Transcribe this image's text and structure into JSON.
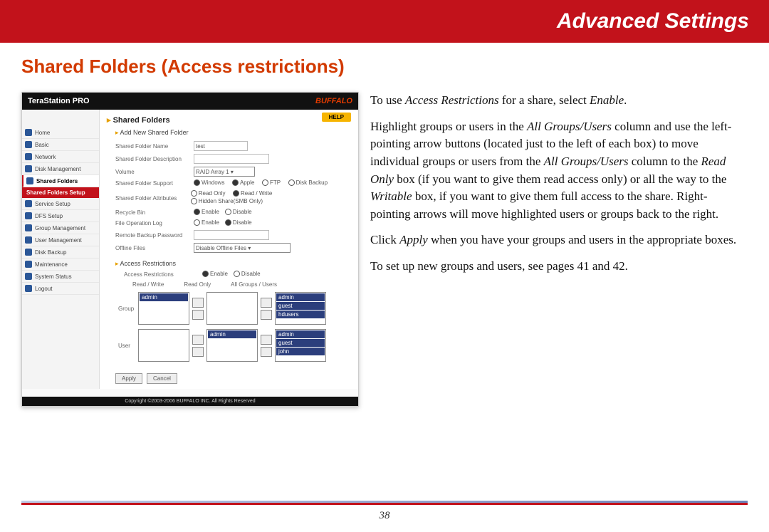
{
  "banner": {
    "title": "Advanced Settings"
  },
  "section_title": "Shared Folders (Access restrictions)",
  "page_number": "38",
  "shot": {
    "product": "TeraStation PRO",
    "brand": "BUFFALO",
    "help": "HELP",
    "sidebar": [
      "Home",
      "Basic",
      "Network",
      "Disk Management",
      "Shared Folders",
      "Service Setup",
      "DFS Setup",
      "Group Management",
      "User Management",
      "Disk Backup",
      "Maintenance",
      "System Status",
      "Logout"
    ],
    "sidebar_sub": "Shared Folders Setup",
    "main_title": "Shared Folders",
    "add_section": "Add New Shared Folder",
    "fields": [
      {
        "label": "Shared Folder Name",
        "value": "test"
      },
      {
        "label": "Shared Folder Description",
        "value": ""
      },
      {
        "label": "Volume",
        "value": "RAID Array 1 ▾"
      },
      {
        "label": "Shared Folder Support",
        "value": ""
      },
      {
        "label": "Shared Folder Attributes",
        "value": ""
      },
      {
        "label": "Recycle Bin",
        "value": ""
      },
      {
        "label": "File Operation Log",
        "value": ""
      },
      {
        "label": "Remote Backup Password",
        "value": ""
      },
      {
        "label": "Offline Files",
        "value": "Disable Offline Files ▾"
      }
    ],
    "support": [
      "Windows",
      "Apple",
      "FTP",
      "Disk Backup"
    ],
    "attrs": [
      "Read Only",
      "Read / Write",
      "Hidden Share(SMB Only)"
    ],
    "enable_disable": [
      "Enable",
      "Disable"
    ],
    "ar_section": "Access Restrictions",
    "ar_label": "Access Restrictions",
    "cols": [
      "Read / Write",
      "Read Only",
      "All Groups / Users"
    ],
    "rows": [
      "Group",
      "User"
    ],
    "group_rw": [
      "admin"
    ],
    "group_all": [
      "admin",
      "guest",
      "hdusers"
    ],
    "user_ro": [
      "admin"
    ],
    "user_all": [
      "admin",
      "guest",
      "john"
    ],
    "buttons": [
      "Apply",
      "Cancel"
    ],
    "footer": "Copyright ©2003-2006 BUFFALO INC. All Rights Reserved"
  },
  "prose": {
    "p1a": "To use",
    "p1i1": "Access Restrictions",
    "p1b": "for a share, select",
    "p1i2": "Enable",
    "p1c": ".",
    "p2a": "Highlight groups or users in the",
    "p2i1": "All Groups/Users",
    "p2b": "column and use the left-pointing arrow buttons (located just to the left of each box) to move individual groups or users from the",
    "p2i2": "All Groups/Users",
    "p2c": "column to the",
    "p2i3": "Read Only",
    "p2d": "box (if you want to give them read access only) or all the way to the",
    "p2i4": "Writable",
    "p2e": "box, if you want to give them full access to the share.  Right-pointing arrows will move highlighted users or groups back to the right.",
    "p3a": "Click",
    "p3i1": "Apply",
    "p3b": "when you have your groups and users in the appropriate boxes.",
    "p4": "To set up new groups and users, see pages 41 and 42."
  }
}
